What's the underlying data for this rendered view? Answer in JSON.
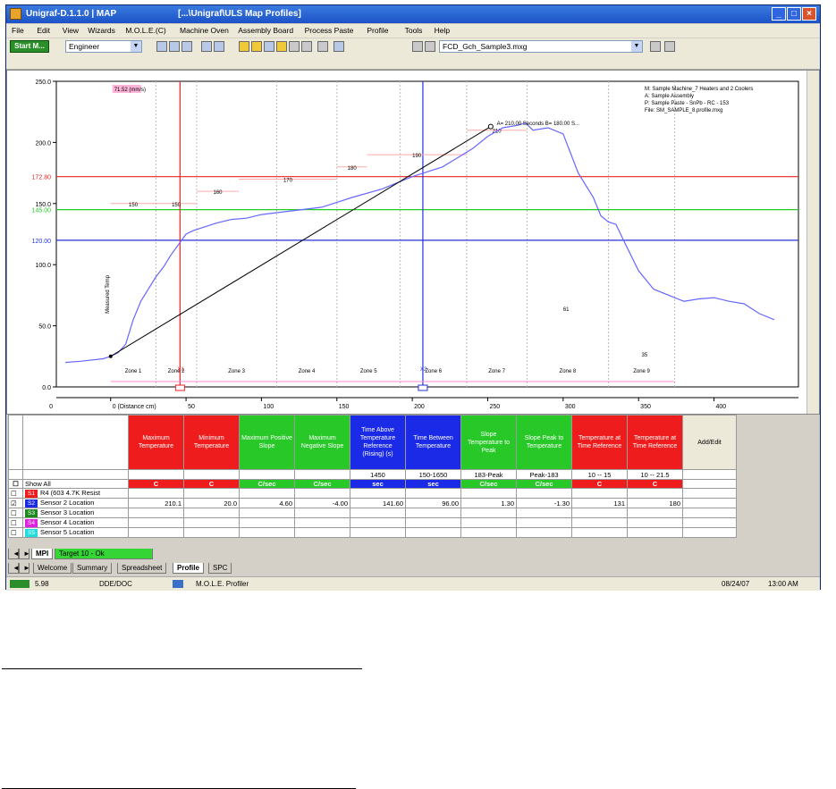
{
  "window": {
    "app_title": "Unigraf-D.1.1.0 | MAP",
    "doc_title": "[...\\Unigraf\\ULS Map Profiles]",
    "min": "_",
    "max": "□",
    "close": "×"
  },
  "menu": [
    "File",
    "Edit",
    "View",
    "Wizards",
    "M.O.L.E.(C)",
    "Machine Oven",
    "Assembly Board",
    "Process Paste",
    "Profile",
    "Tools",
    "Help"
  ],
  "toolbar": {
    "start_label": "Start M...",
    "user_select": "Engineer",
    "file_select": "FCD_Gch_Sample3.mxg",
    "dropdown_arrow": "▼"
  },
  "chart_data": {
    "type": "line",
    "xlabel": "",
    "ylabel": "Measured Temp",
    "xlim": [
      0,
      450
    ],
    "ylim": [
      0,
      250
    ],
    "yticks": [
      "250.0",
      "200.0",
      "150.0",
      "100.0",
      "50.0",
      "0.0"
    ],
    "ytick_values": [
      250,
      200,
      150,
      100,
      50,
      0
    ],
    "xticks": [
      "0 (Distance cm)",
      "50",
      "100",
      "150",
      "200",
      "250",
      "300",
      "350",
      "400"
    ],
    "xtick_values": [
      0,
      50,
      100,
      150,
      200,
      250,
      300,
      350,
      400
    ],
    "xaxis_start": "0",
    "series": [
      {
        "color": "#6666ff",
        "x": [
          -30,
          -20,
          -5,
          0,
          5,
          10,
          15,
          20,
          25,
          30,
          35,
          40,
          50,
          55,
          60,
          70,
          80,
          90,
          100,
          120,
          140,
          160,
          180,
          200,
          220,
          240,
          250,
          260,
          270,
          275,
          280,
          290,
          300,
          310,
          320,
          325,
          330,
          335,
          340,
          350,
          360,
          370,
          380,
          390,
          400,
          410,
          420,
          430,
          440
        ],
        "y": [
          20,
          21,
          23,
          25,
          28,
          35,
          55,
          70,
          80,
          90,
          98,
          108,
          125,
          128,
          130,
          134,
          137,
          138,
          141,
          144,
          147,
          155,
          162,
          172,
          180,
          195,
          205,
          212,
          214,
          216,
          210,
          212,
          207,
          175,
          155,
          140,
          135,
          133,
          120,
          95,
          80,
          75,
          70,
          72,
          73,
          70,
          68,
          60,
          55
        ]
      },
      {
        "color": "#000000",
        "x": [
          0,
          252
        ],
        "y": [
          25,
          213
        ]
      }
    ],
    "hlines": [
      {
        "y": 172,
        "label": "172.80",
        "color": "#ee2222"
      },
      {
        "y": 145,
        "label": "145.00",
        "color": "#22cc22"
      },
      {
        "y": 120,
        "label": "120.00",
        "color": "#2233dd"
      }
    ],
    "vlines": [
      {
        "x": 46,
        "color": "#ee2222",
        "label": "X1"
      },
      {
        "x": 207,
        "color": "#2233dd",
        "label": "X2"
      }
    ],
    "zones": [
      "Zone 1",
      "Zone 2",
      "Zone 3",
      "Zone 4",
      "Zone 5",
      "Zone 6",
      "Zone 7",
      "Zone 8",
      "Zone 9"
    ],
    "zone_setpoints": [
      "150",
      "150",
      "160",
      "170",
      "180",
      "190",
      "210"
    ],
    "annotation_top": "71.52 (mm/s)",
    "peak_label": "A= 210.00 Seconds B= 180.00 S...",
    "info_lines": [
      "M: Sample Machine_7 Heaters and 2 Coolers",
      "A: Sample Assembly",
      "P: Sample Paste - SnPb - RC - 153",
      "File: SM_SAMPLE_8.profile.mxg"
    ],
    "zone8_value": "61",
    "zone9_value": "35",
    "grid": false,
    "legend": "none"
  },
  "grid": {
    "headers": [
      {
        "text": "Maximum Temperature",
        "color": "red"
      },
      {
        "text": "Minimum Temperature",
        "color": "red"
      },
      {
        "text": "Maximum Positive Slope",
        "color": "grn"
      },
      {
        "text": "Maximum Negative Slope",
        "color": "grn"
      },
      {
        "text": "Time Above Temperature Reference (Rising) (s)",
        "color": "blu"
      },
      {
        "text": "Time Between Temperature",
        "color": "blu"
      },
      {
        "text": "Slope Temperature to Peak",
        "color": "grn"
      },
      {
        "text": "Slope Peak to Temperature",
        "color": "grn"
      },
      {
        "text": "Temperature at Time Reference",
        "color": "red"
      },
      {
        "text": "Temperature at Time Reference",
        "color": "red"
      }
    ],
    "add_button": "Add/Edit",
    "spec_row": [
      "",
      "",
      "",
      "",
      "1450",
      "150-1650",
      "183-Peak",
      "Peak-183",
      "10 -- 15",
      "10 -- 21.5"
    ],
    "band_row": [
      {
        "text": "C",
        "color": "red"
      },
      {
        "text": "C",
        "color": "red"
      },
      {
        "text": "C/sec",
        "color": "grn"
      },
      {
        "text": "C/sec",
        "color": "grn"
      },
      {
        "text": "sec",
        "color": "blu"
      },
      {
        "text": "sec",
        "color": "blu"
      },
      {
        "text": "C/sec",
        "color": "grn"
      },
      {
        "text": "C/sec",
        "color": "grn"
      },
      {
        "text": "C",
        "color": "red"
      },
      {
        "text": "C",
        "color": "red"
      }
    ],
    "show_all": "Show All",
    "rows": [
      {
        "badge": "S1",
        "badge_color": "#ee1c1c",
        "name": "R4 (603 4.7K Resist",
        "values": [
          "",
          "",
          "",
          "",
          "",
          "",
          "",
          "",
          "",
          ""
        ]
      },
      {
        "badge": "S2",
        "badge_color": "#1a2ae6",
        "name": "Sensor 2 Location",
        "values": [
          "210.1",
          "20.0",
          "4.60",
          "-4.00",
          "141.60",
          "96.00",
          "1.30",
          "-1.30",
          "131",
          "180"
        ]
      },
      {
        "badge": "S3",
        "badge_color": "#1e8a1e",
        "name": "Sensor 3 Location",
        "values": [
          "",
          "",
          "",
          "",
          "",
          "",
          "",
          "",
          "",
          ""
        ]
      },
      {
        "badge": "S4",
        "badge_color": "#e020e0",
        "name": "Sensor 4 Location",
        "values": [
          "",
          "",
          "",
          "",
          "",
          "",
          "",
          "",
          "",
          ""
        ]
      },
      {
        "badge": "S5",
        "badge_color": "#22dddd",
        "name": "Sensor 5 Location",
        "values": [
          "",
          "",
          "",
          "",
          "",
          "",
          "",
          "",
          "",
          ""
        ]
      }
    ]
  },
  "subtabs": [
    "MPI",
    "Target 10 - Ok"
  ],
  "tabs": [
    "Welcome",
    "Summary",
    "Spreadsheet",
    "Profile",
    "SPC"
  ],
  "status": {
    "version": "5.98",
    "mode": "DDE/DOC",
    "app": "M.O.L.E. Profiler",
    "date": "08/24/07",
    "time": "13:00 AM"
  }
}
